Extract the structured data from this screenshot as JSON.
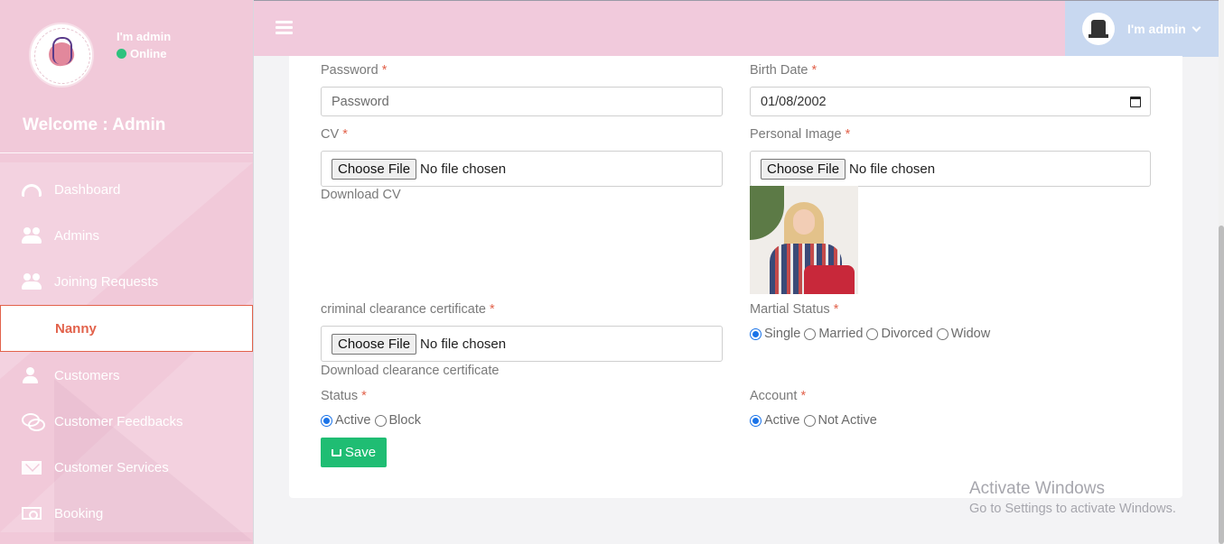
{
  "sidebar": {
    "user_name": "I'm admin",
    "status": "Online",
    "welcome": "Welcome : Admin",
    "items": [
      {
        "label": "Dashboard",
        "icon": "dashboard-icon"
      },
      {
        "label": "Admins",
        "icon": "users-icon"
      },
      {
        "label": "Joining Requests",
        "icon": "users-icon"
      },
      {
        "label": "Nanny",
        "icon": "",
        "active": true
      },
      {
        "label": "Customers",
        "icon": "user-icon"
      },
      {
        "label": "Customer Feedbacks",
        "icon": "comments-icon"
      },
      {
        "label": "Customer Services",
        "icon": "envelope-icon"
      },
      {
        "label": "Booking",
        "icon": "money-icon"
      }
    ]
  },
  "header": {
    "menu_icon": "hamburger-icon",
    "user_name": "I'm admin"
  },
  "form": {
    "password": {
      "label": "Password",
      "required": "*",
      "placeholder": "Password",
      "value": ""
    },
    "birth_date": {
      "label": "Birth Date",
      "required": "*",
      "value": "01/08/2002"
    },
    "cv": {
      "label": "CV",
      "required": "*",
      "button": "Choose File",
      "status": "No file chosen",
      "link": "Download CV"
    },
    "personal_image": {
      "label": "Personal Image",
      "required": "*",
      "button": "Choose File",
      "status": "No file chosen"
    },
    "criminal": {
      "label": "criminal clearance certificate",
      "required": "*",
      "button": "Choose File",
      "status": "No file chosen",
      "link": "Download clearance certificate"
    },
    "marital": {
      "label": "Martial Status",
      "required": "*",
      "options": [
        "Single",
        "Married",
        "Divorced",
        "Widow"
      ],
      "selected": "Single"
    },
    "status": {
      "label": "Status",
      "required": "*",
      "options": [
        "Active",
        "Block"
      ],
      "selected": "Active"
    },
    "account": {
      "label": "Account",
      "required": "*",
      "options": [
        "Active",
        "Not Active"
      ],
      "selected": "Active"
    },
    "save_label": "Save"
  },
  "watermark": {
    "title": "Activate Windows",
    "subtitle": "Go to Settings to activate Windows."
  },
  "colors": {
    "sidebar_bg": "#f1c9d9",
    "header_bg": "#f1cadc",
    "user_menu_bg": "#c8d8f0",
    "active_accent": "#e2624b",
    "save_button": "#1fbd73",
    "online_dot": "#2ec27e"
  }
}
